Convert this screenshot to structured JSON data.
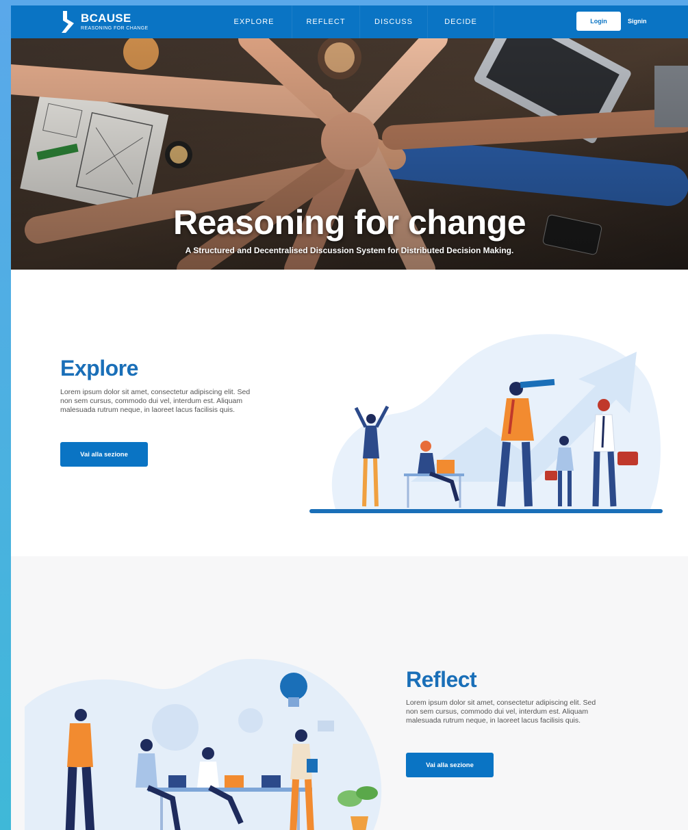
{
  "nav": {
    "brand_name": "BCAUSE",
    "brand_tagline": "REASONING FOR CHANGE",
    "links": [
      "EXPLORE",
      "REFLECT",
      "DISCUSS",
      "DECIDE"
    ],
    "login_label": "Login",
    "signin_label": "Signin"
  },
  "hero": {
    "title": "Reasoning for change",
    "subtitle": "A Structured and Decentralised Discussion System for Distributed Decision Making."
  },
  "explore": {
    "heading": "Explore",
    "body": "Lorem ipsum dolor sit amet, consectetur adipiscing elit. Sed non sem cursus, commodo dui vel, interdum est. Aliquam malesuada rutrum neque, in laoreet lacus facilisis quis.",
    "button_label": "Vai alla sezione"
  },
  "reflect": {
    "heading": "Reflect",
    "body": "Lorem ipsum dolor sit amet, consectetur adipiscing elit. Sed non sem cursus, commodo dui vel, interdum est. Aliquam malesuada rutrum neque, in laoreet lacus facilisis quis.",
    "button_label": "Vai alla sezione"
  },
  "colors": {
    "brand_blue": "#0a74c4",
    "heading_blue": "#1a6fb8",
    "accent_orange": "#f28b30",
    "frame_gradient_top": "#5aa8ea",
    "frame_gradient_bottom": "#3fb8d8"
  },
  "icons": {
    "brand_logo": "bcause-logo-icon",
    "explore_illustration": "team-with-telescope-illustration",
    "reflect_illustration": "team-brainstorm-lightbulb-illustration"
  }
}
